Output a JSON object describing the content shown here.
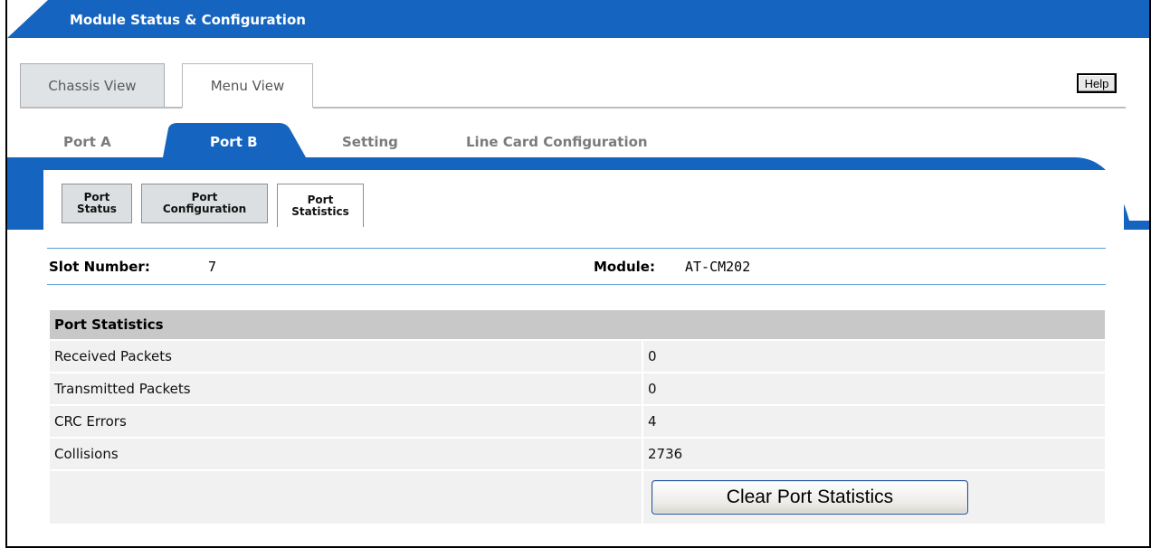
{
  "header": {
    "title": "Module Status & Configuration"
  },
  "view_tabs": [
    {
      "label": "Chassis View",
      "active": false
    },
    {
      "label": "Menu View",
      "active": true
    }
  ],
  "help": {
    "label": "Help"
  },
  "port_tabs": [
    {
      "label": "Port A",
      "active": false
    },
    {
      "label": "Port B",
      "active": true
    },
    {
      "label": "Setting",
      "active": false
    },
    {
      "label": "Line Card Configuration",
      "active": false
    }
  ],
  "sub_tabs": [
    {
      "line1": "Port",
      "line2": "Status",
      "active": false
    },
    {
      "line1": "Port",
      "line2": "Configuration",
      "active": false
    },
    {
      "line1": "Port",
      "line2": "Statistics",
      "active": true
    }
  ],
  "info": {
    "slot_label": "Slot Number:",
    "slot_value": "7",
    "module_label": "Module:",
    "module_value": "AT-CM202"
  },
  "stats": {
    "heading": "Port Statistics",
    "rows": [
      {
        "label": "Received Packets",
        "value": "0"
      },
      {
        "label": "Transmitted Packets",
        "value": "0"
      },
      {
        "label": "CRC Errors",
        "value": "4"
      },
      {
        "label": "Collisions",
        "value": "2736"
      }
    ],
    "clear_button": "Clear Port Statistics"
  },
  "colors": {
    "brand_blue": "#1565c0",
    "tab_gray": "#dfe3e6",
    "table_header": "#c8c8c8",
    "row_bg": "#f1f1f1"
  }
}
